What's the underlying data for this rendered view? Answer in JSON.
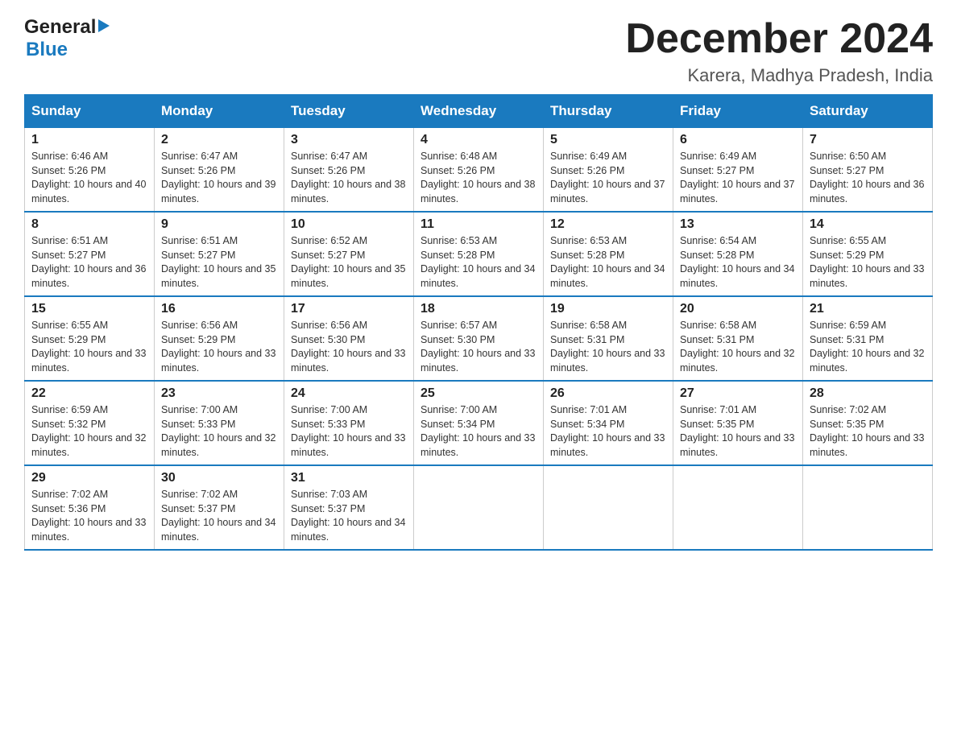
{
  "header": {
    "logo_general": "General",
    "logo_blue": "Blue",
    "title": "December 2024",
    "subtitle": "Karera, Madhya Pradesh, India"
  },
  "columns": [
    "Sunday",
    "Monday",
    "Tuesday",
    "Wednesday",
    "Thursday",
    "Friday",
    "Saturday"
  ],
  "weeks": [
    [
      {
        "day": "1",
        "sunrise": "6:46 AM",
        "sunset": "5:26 PM",
        "daylight": "10 hours and 40 minutes."
      },
      {
        "day": "2",
        "sunrise": "6:47 AM",
        "sunset": "5:26 PM",
        "daylight": "10 hours and 39 minutes."
      },
      {
        "day": "3",
        "sunrise": "6:47 AM",
        "sunset": "5:26 PM",
        "daylight": "10 hours and 38 minutes."
      },
      {
        "day": "4",
        "sunrise": "6:48 AM",
        "sunset": "5:26 PM",
        "daylight": "10 hours and 38 minutes."
      },
      {
        "day": "5",
        "sunrise": "6:49 AM",
        "sunset": "5:26 PM",
        "daylight": "10 hours and 37 minutes."
      },
      {
        "day": "6",
        "sunrise": "6:49 AM",
        "sunset": "5:27 PM",
        "daylight": "10 hours and 37 minutes."
      },
      {
        "day": "7",
        "sunrise": "6:50 AM",
        "sunset": "5:27 PM",
        "daylight": "10 hours and 36 minutes."
      }
    ],
    [
      {
        "day": "8",
        "sunrise": "6:51 AM",
        "sunset": "5:27 PM",
        "daylight": "10 hours and 36 minutes."
      },
      {
        "day": "9",
        "sunrise": "6:51 AM",
        "sunset": "5:27 PM",
        "daylight": "10 hours and 35 minutes."
      },
      {
        "day": "10",
        "sunrise": "6:52 AM",
        "sunset": "5:27 PM",
        "daylight": "10 hours and 35 minutes."
      },
      {
        "day": "11",
        "sunrise": "6:53 AM",
        "sunset": "5:28 PM",
        "daylight": "10 hours and 34 minutes."
      },
      {
        "day": "12",
        "sunrise": "6:53 AM",
        "sunset": "5:28 PM",
        "daylight": "10 hours and 34 minutes."
      },
      {
        "day": "13",
        "sunrise": "6:54 AM",
        "sunset": "5:28 PM",
        "daylight": "10 hours and 34 minutes."
      },
      {
        "day": "14",
        "sunrise": "6:55 AM",
        "sunset": "5:29 PM",
        "daylight": "10 hours and 33 minutes."
      }
    ],
    [
      {
        "day": "15",
        "sunrise": "6:55 AM",
        "sunset": "5:29 PM",
        "daylight": "10 hours and 33 minutes."
      },
      {
        "day": "16",
        "sunrise": "6:56 AM",
        "sunset": "5:29 PM",
        "daylight": "10 hours and 33 minutes."
      },
      {
        "day": "17",
        "sunrise": "6:56 AM",
        "sunset": "5:30 PM",
        "daylight": "10 hours and 33 minutes."
      },
      {
        "day": "18",
        "sunrise": "6:57 AM",
        "sunset": "5:30 PM",
        "daylight": "10 hours and 33 minutes."
      },
      {
        "day": "19",
        "sunrise": "6:58 AM",
        "sunset": "5:31 PM",
        "daylight": "10 hours and 33 minutes."
      },
      {
        "day": "20",
        "sunrise": "6:58 AM",
        "sunset": "5:31 PM",
        "daylight": "10 hours and 32 minutes."
      },
      {
        "day": "21",
        "sunrise": "6:59 AM",
        "sunset": "5:31 PM",
        "daylight": "10 hours and 32 minutes."
      }
    ],
    [
      {
        "day": "22",
        "sunrise": "6:59 AM",
        "sunset": "5:32 PM",
        "daylight": "10 hours and 32 minutes."
      },
      {
        "day": "23",
        "sunrise": "7:00 AM",
        "sunset": "5:33 PM",
        "daylight": "10 hours and 32 minutes."
      },
      {
        "day": "24",
        "sunrise": "7:00 AM",
        "sunset": "5:33 PM",
        "daylight": "10 hours and 33 minutes."
      },
      {
        "day": "25",
        "sunrise": "7:00 AM",
        "sunset": "5:34 PM",
        "daylight": "10 hours and 33 minutes."
      },
      {
        "day": "26",
        "sunrise": "7:01 AM",
        "sunset": "5:34 PM",
        "daylight": "10 hours and 33 minutes."
      },
      {
        "day": "27",
        "sunrise": "7:01 AM",
        "sunset": "5:35 PM",
        "daylight": "10 hours and 33 minutes."
      },
      {
        "day": "28",
        "sunrise": "7:02 AM",
        "sunset": "5:35 PM",
        "daylight": "10 hours and 33 minutes."
      }
    ],
    [
      {
        "day": "29",
        "sunrise": "7:02 AM",
        "sunset": "5:36 PM",
        "daylight": "10 hours and 33 minutes."
      },
      {
        "day": "30",
        "sunrise": "7:02 AM",
        "sunset": "5:37 PM",
        "daylight": "10 hours and 34 minutes."
      },
      {
        "day": "31",
        "sunrise": "7:03 AM",
        "sunset": "5:37 PM",
        "daylight": "10 hours and 34 minutes."
      },
      null,
      null,
      null,
      null
    ]
  ]
}
